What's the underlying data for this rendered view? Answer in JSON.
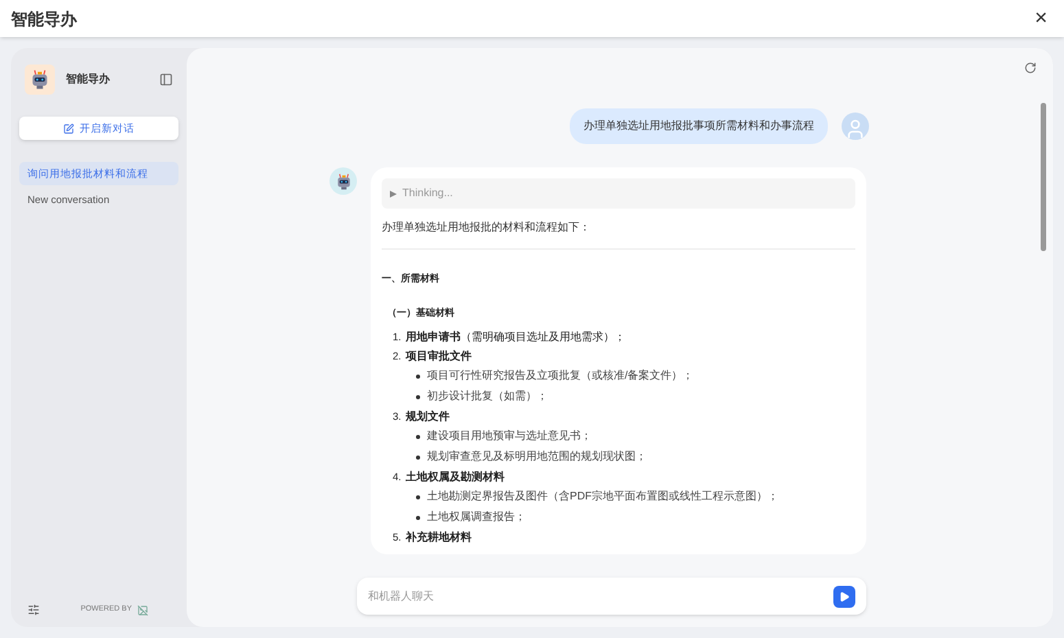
{
  "window": {
    "title": "智能导办",
    "close": "×"
  },
  "sidebar": {
    "app_name": "智能导办",
    "new_chat": "开启新对话",
    "items": [
      {
        "label": "询问用地报批材料和流程",
        "selected": true
      },
      {
        "label": "New conversation",
        "selected": false
      }
    ],
    "powered_by": "POWERED BY"
  },
  "chat": {
    "user_message": "办理单独选址用地报批事项所需材料和办事流程",
    "thinking": {
      "label": "Thinking...",
      "expanded": false
    },
    "intro": "办理单独选址用地报批的材料和流程如下：",
    "blocks": [
      {
        "kind": "heading",
        "text": "一、所需材料"
      },
      {
        "kind": "subheading",
        "text": "（一）基础材料"
      },
      {
        "kind": "item",
        "number": "1.",
        "text": "**用地申请书**（需明确项目选址及用地需求）；"
      },
      {
        "kind": "item",
        "number": "2.",
        "text": "**项目审批文件**",
        "children": [
          "项目可行性研究报告及立项批复（或核准/备案文件）；",
          "初步设计批复（如需）；"
        ]
      },
      {
        "kind": "item",
        "number": "3.",
        "text": "**规划文件**",
        "children": [
          "建设项目用地预审与选址意见书；",
          "规划审查意见及标明用地范围的规划现状图；"
        ]
      },
      {
        "kind": "item",
        "number": "4.",
        "text": "**土地权属及勘测材料**",
        "children": [
          "土地勘测定界报告及图件（含PDF宗地平面布置图或线性工程示意图）；",
          "土地权属调查报告；"
        ]
      },
      {
        "kind": "item",
        "number": "5.",
        "text": "**补充耕地材料**"
      }
    ],
    "input": {
      "placeholder": "和机器人聊天"
    }
  }
}
